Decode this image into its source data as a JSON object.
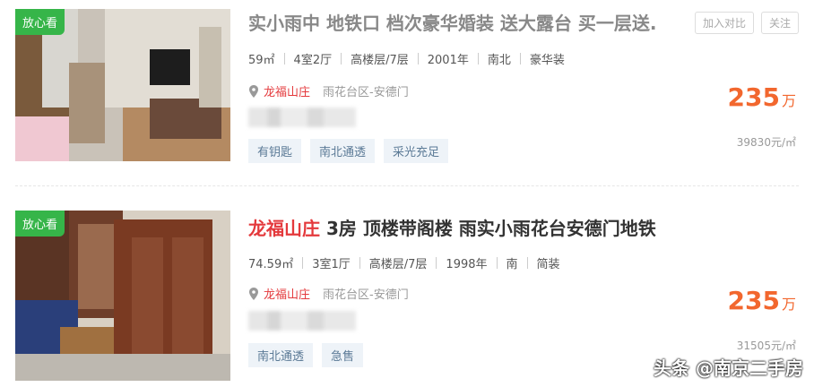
{
  "listings": [
    {
      "badge": "放心看",
      "title_plain": "实小雨中 地铁口 档次豪华婚装 送大露台 买一层送.",
      "meta": [
        "59㎡",
        "4室2厅",
        "高楼层/7层",
        "2001年",
        "南北",
        "豪华装"
      ],
      "estate": "龙福山庄",
      "district": "雨花台区-安德门",
      "tags": [
        "有钥匙",
        "南北通透",
        "采光充足"
      ],
      "price": "235",
      "price_unit": "万",
      "unit_price": "39830元/㎡",
      "actions": [
        "加入对比",
        "关注"
      ]
    },
    {
      "badge": "放心看",
      "title_highlight": "龙福山庄",
      "title_rest": " 3房 顶楼带阁楼 雨实小雨花台安德门地铁",
      "meta": [
        "74.59㎡",
        "3室1厅",
        "高楼层/7层",
        "1998年",
        "南",
        "简装"
      ],
      "estate": "龙福山庄",
      "district": "雨花台区-安德门",
      "tags": [
        "南北通透",
        "急售"
      ],
      "price": "235",
      "price_unit": "万",
      "unit_price": "31505元/㎡"
    }
  ],
  "watermark": "头条 @南京二手房",
  "colors": {
    "badge": "#36b549",
    "price": "#f2672e",
    "highlight": "#e4393c",
    "tag_bg": "#eef3f8",
    "tag_text": "#5b7a96"
  }
}
